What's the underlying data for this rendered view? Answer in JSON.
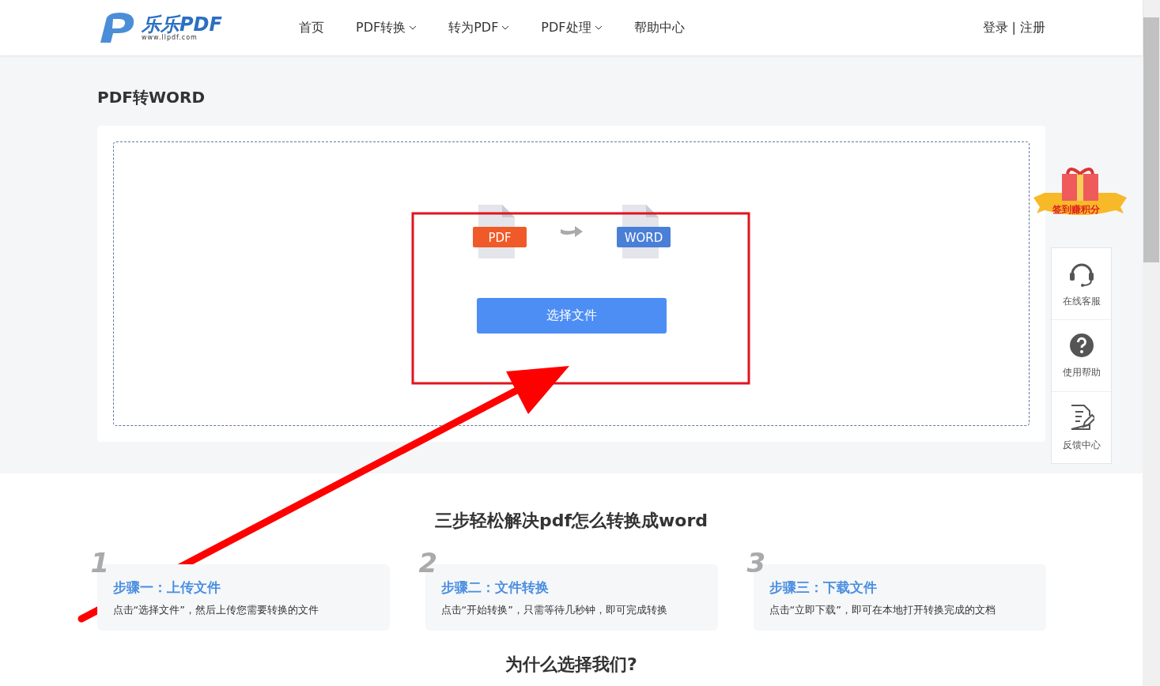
{
  "header": {
    "logo": {
      "name": "乐乐PDF",
      "url": "www.llpdf.com"
    },
    "nav": [
      {
        "label": "首页",
        "dropdown": false
      },
      {
        "label": "PDF转换",
        "dropdown": true
      },
      {
        "label": "转为PDF",
        "dropdown": true
      },
      {
        "label": "PDF处理",
        "dropdown": true
      },
      {
        "label": "帮助中心",
        "dropdown": false
      }
    ],
    "login": "登录",
    "separator": "|",
    "register": "注册"
  },
  "page_title": "PDF转WORD",
  "converter": {
    "from": "PDF",
    "to": "WORD",
    "button": "选择文件"
  },
  "gift_badge": "签到赚积分",
  "side_tools": [
    {
      "kind": "headset",
      "label": "在线客服"
    },
    {
      "kind": "help",
      "label": "使用帮助"
    },
    {
      "kind": "feedback",
      "label": "反馈中心"
    }
  ],
  "steps_title": "三步轻松解决pdf怎么转换成word",
  "steps": [
    {
      "number": "1",
      "title": "步骤一：上传文件",
      "text": "点击“选择文件”，然后上传您需要转换的文件"
    },
    {
      "number": "2",
      "title": "步骤二：文件转换",
      "text": "点击“开始转换”，只需等待几秒钟，即可完成转换"
    },
    {
      "number": "3",
      "title": "步骤三：下载文件",
      "text": "点击“立即下载”，即可在本地打开转换完成的文档"
    }
  ],
  "why_title": "为什么选择我们?"
}
